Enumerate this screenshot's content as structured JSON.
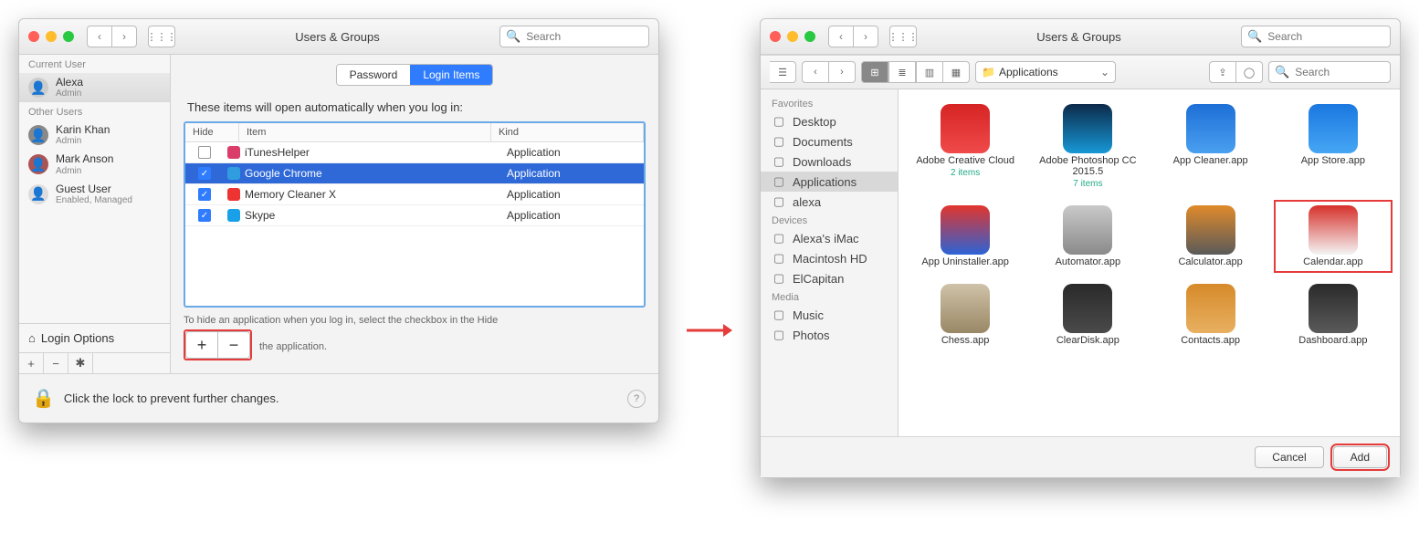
{
  "win1": {
    "title": "Users & Groups",
    "search_placeholder": "Search",
    "tabs": {
      "password": "Password",
      "login": "Login Items"
    },
    "subtitle": "These items will open automatically when you log in:",
    "cols": {
      "hide": "Hide",
      "item": "Item",
      "kind": "Kind"
    },
    "rows": [
      {
        "hide": false,
        "icon": "#db3d6a",
        "name": "iTunesHelper",
        "kind": "Application",
        "selected": false
      },
      {
        "hide": true,
        "icon": "#2f9de0",
        "name": "Google Chrome",
        "kind": "Application",
        "selected": true
      },
      {
        "hide": true,
        "icon": "#e33",
        "name": "Memory Cleaner X",
        "kind": "Application",
        "selected": false
      },
      {
        "hide": true,
        "icon": "#1aa0e8",
        "name": "Skype",
        "kind": "Application",
        "selected": false
      }
    ],
    "hint2a": "To hide an application when you log in, select the checkbox in the Hide",
    "hint2b": "the application.",
    "sidebar": {
      "current_hdr": "Current User",
      "other_hdr": "Other Users",
      "current": {
        "name": "Alexa",
        "role": "Admin"
      },
      "others": [
        {
          "name": "Karin Khan",
          "role": "Admin"
        },
        {
          "name": "Mark Anson",
          "role": "Admin"
        },
        {
          "name": "Guest User",
          "role": "Enabled, Managed"
        }
      ],
      "login_options": "Login Options"
    },
    "lock_text": "Click the lock to prevent further changes."
  },
  "win2": {
    "title": "Users & Groups",
    "search_placeholder": "Search",
    "path_popup": "Applications",
    "sidebar": {
      "fav_hdr": "Favorites",
      "favorites": [
        "Desktop",
        "Documents",
        "Downloads",
        "Applications",
        "alexa"
      ],
      "dev_hdr": "Devices",
      "devices": [
        "Alexa's iMac",
        "Macintosh HD",
        "ElCapitan"
      ],
      "media_hdr": "Media",
      "media": [
        "Music",
        "Photos"
      ]
    },
    "apps": [
      {
        "name": "Adobe Creative Cloud",
        "sub": "2 items",
        "c1": "#d62424",
        "c2": "#f04a4a",
        "hi": false
      },
      {
        "name": "Adobe Photoshop CC 2015.5",
        "sub": "7 items",
        "c1": "#0c2a4a",
        "c2": "#1798d6",
        "hi": false
      },
      {
        "name": "App Cleaner.app",
        "sub": "",
        "c1": "#1d6fd6",
        "c2": "#4aa0f0",
        "hi": false
      },
      {
        "name": "App Store.app",
        "sub": "",
        "c1": "#1a78e0",
        "c2": "#46a6f4",
        "hi": false
      },
      {
        "name": "App Uninstaller.app",
        "sub": "",
        "c1": "#e2352d",
        "c2": "#2b63d6",
        "hi": false
      },
      {
        "name": "Automator.app",
        "sub": "",
        "c1": "#c9c9c9",
        "c2": "#8a8a8a",
        "hi": false
      },
      {
        "name": "Calculator.app",
        "sub": "",
        "c1": "#e08a2a",
        "c2": "#5a5a5a",
        "hi": false
      },
      {
        "name": "Calendar.app",
        "sub": "",
        "c1": "#d6302a",
        "c2": "#f4f4f4",
        "hi": true
      },
      {
        "name": "Chess.app",
        "sub": "",
        "c1": "#d0c2a8",
        "c2": "#9a8866",
        "hi": false
      },
      {
        "name": "ClearDisk.app",
        "sub": "",
        "c1": "#2a2a2a",
        "c2": "#4a4a4a",
        "hi": false
      },
      {
        "name": "Contacts.app",
        "sub": "",
        "c1": "#d68a2a",
        "c2": "#e8b060",
        "hi": false
      },
      {
        "name": "Dashboard.app",
        "sub": "",
        "c1": "#2a2a2a",
        "c2": "#5a5a5a",
        "hi": false
      }
    ],
    "cancel": "Cancel",
    "add": "Add"
  }
}
